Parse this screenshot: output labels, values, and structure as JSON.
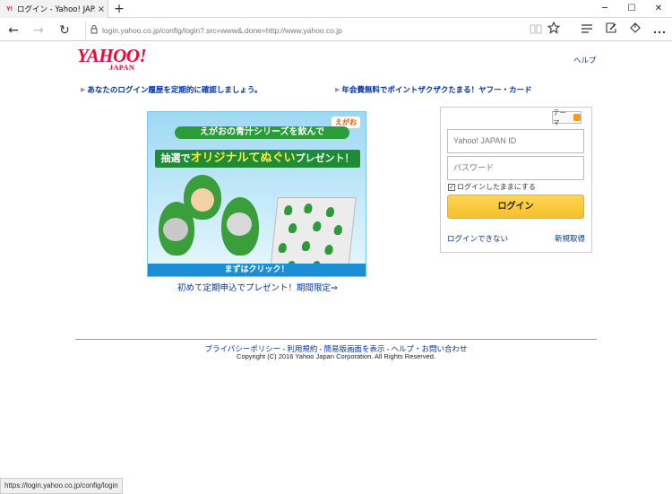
{
  "browser": {
    "tab_title": "ログイン - Yahoo! JAPAN",
    "favicon_text": "Y!",
    "tab_close": "×",
    "new_tab": "+",
    "url": "login.yahoo.co.jp/config/login?.src=www&.done=http://www.yahoo.co.jp",
    "window_controls": [
      "─",
      "☐",
      "✕"
    ],
    "nav": {
      "back": "←",
      "forward": "→",
      "refresh": "↻"
    },
    "toolbar_icons": [
      "reading-view-icon",
      "favorite-star-icon",
      "hub-icon",
      "note-icon",
      "share-icon",
      "more-icon"
    ],
    "status_url": "https://login.yahoo.co.jp/config/login"
  },
  "header": {
    "logo_main": "YAHOO!",
    "logo_sub": "JAPAN",
    "help": "ヘルプ"
  },
  "promos": [
    "あなたのログイン履歴を定期的に確認しましょう。",
    "年会費無料でポイントザクザクたまる！ヤフー・カード"
  ],
  "banner": {
    "brand": "えがお",
    "headline": "えがおの青汁シリーズを飲んで",
    "ribbon_pre": "抽選で",
    "ribbon_highlight": "オリジナルてぬぐい",
    "ribbon_post": "プレゼント！",
    "cta": "まずはクリック！",
    "link": "初めて定期申込でプレゼント！期間限定⇒"
  },
  "login": {
    "theme": "テーマ",
    "id_placeholder": "Yahoo! JAPAN ID",
    "password_placeholder": "パスワード",
    "keep_checked": true,
    "keep_label": "ログインしたままにする",
    "button": "ログイン",
    "cant_login": "ログインできない",
    "register": "新規取得"
  },
  "footer": {
    "links": [
      "プライバシーポリシー",
      "利用規約",
      "簡易版画面を表示",
      "ヘルプ・お問い合わせ"
    ],
    "separator": "-",
    "copyright": "Copyright (C) 2016 Yahoo Japan Corporation. All Rights Reserved."
  },
  "colors": {
    "brand": "#ff0033",
    "link": "#0033aa",
    "login_button": "#f5c02a"
  }
}
